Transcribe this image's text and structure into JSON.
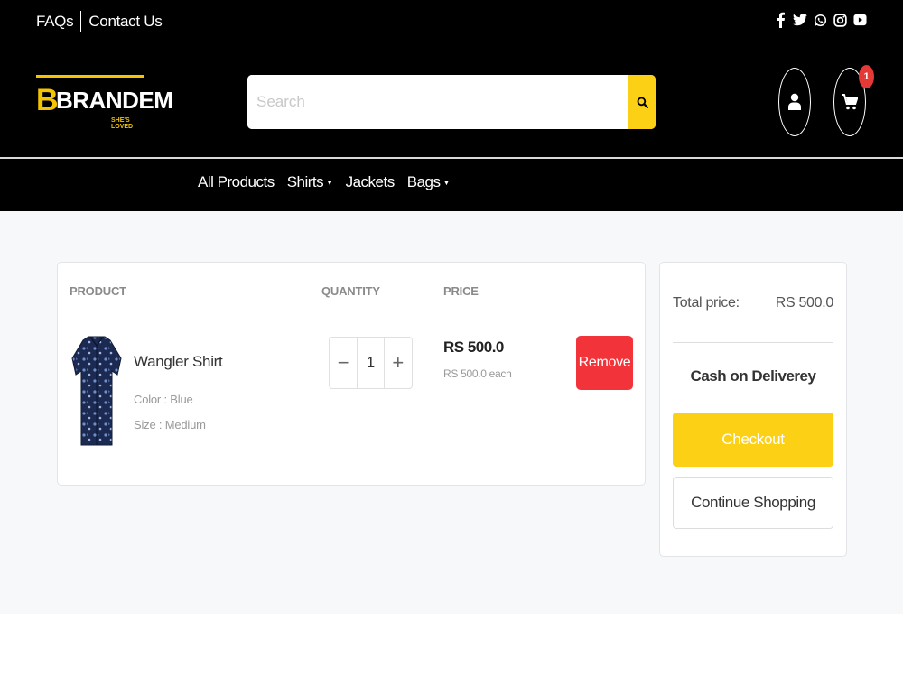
{
  "topbar": {
    "links": [
      "FAQs",
      "Contact Us"
    ],
    "social_icons": [
      "facebook-icon",
      "twitter-icon",
      "whatsapp-icon",
      "instagram-icon",
      "youtube-icon"
    ]
  },
  "brand": {
    "letter": "B",
    "name": "BRANDEM",
    "tagline": "SHE'S LOVED",
    "accent_color": "#f5c400"
  },
  "search": {
    "placeholder": "Search",
    "value": ""
  },
  "header": {
    "cart_count": "1"
  },
  "nav": {
    "items": [
      {
        "label": "All Products",
        "has_dropdown": false
      },
      {
        "label": "Shirts",
        "has_dropdown": true
      },
      {
        "label": "Jackets",
        "has_dropdown": false
      },
      {
        "label": "Bags",
        "has_dropdown": true
      }
    ]
  },
  "cart": {
    "headers": {
      "product": "PRODUCT",
      "quantity": "QUANTITY",
      "price": "PRICE"
    },
    "items": [
      {
        "name": "Wangler Shirt",
        "color": "Color : Blue",
        "size": "Size : Medium",
        "quantity": "1",
        "minus": "−",
        "plus": "+",
        "price": "RS 500.0",
        "each": "RS 500.0 each",
        "remove_label": "Remove"
      }
    ]
  },
  "summary": {
    "total_label": "Total price:",
    "total_value": "RS 500.0",
    "payment_method": "Cash on Deliverey",
    "checkout_label": "Checkout",
    "continue_label": "Continue Shopping"
  },
  "colors": {
    "header_bg": "#000000",
    "accent_yellow": "#fcd015",
    "remove_red": "#f2333a",
    "badge_red": "#e53935",
    "page_bg": "#f7f8fa"
  }
}
